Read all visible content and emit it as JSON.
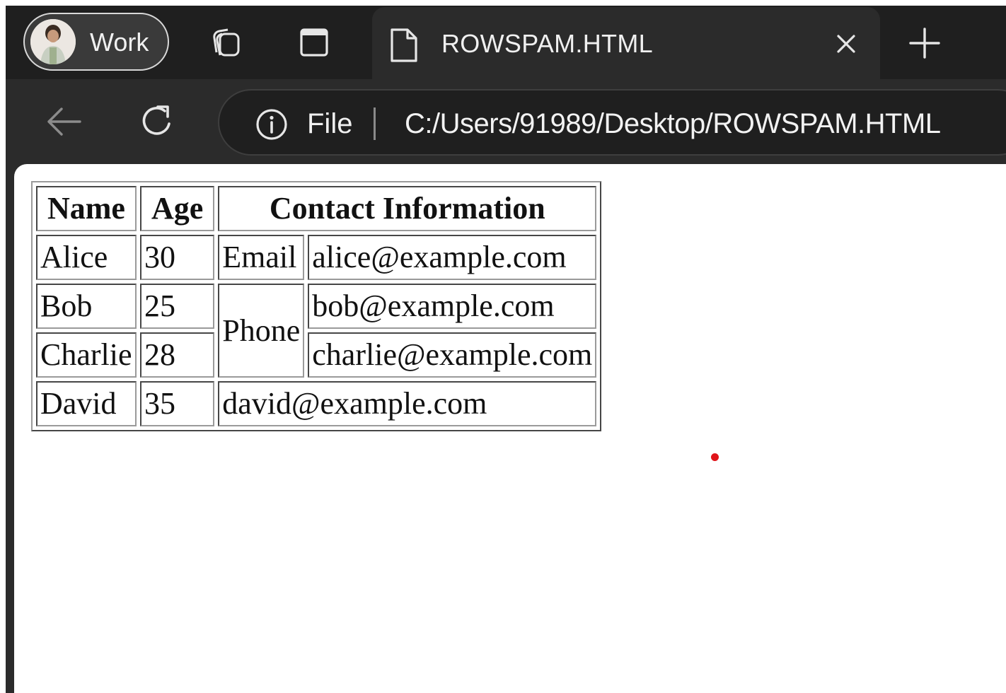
{
  "browser": {
    "profile": {
      "label": "Work"
    },
    "tab": {
      "title": "ROWSPAM.HTML"
    },
    "address": {
      "scheme_label": "File",
      "url": "C:/Users/91989/Desktop/ROWSPAM.HTML"
    },
    "icons": {
      "workspaces": "workspaces-icon",
      "tab_actions": "tab-actions-icon",
      "document": "document-icon",
      "close": "close-icon",
      "new_tab": "plus-icon",
      "back": "back-arrow-icon",
      "reload": "reload-icon",
      "info": "info-icon"
    },
    "colors": {
      "chrome_dark": "#1f1f1f",
      "chrome": "#2b2b2b",
      "text": "#f0f0f0"
    }
  },
  "table": {
    "headers": [
      "Name",
      "Age",
      "Contact Information"
    ],
    "rows": [
      {
        "name": "Alice",
        "age": "30",
        "method": "Email",
        "contact": "alice@example.com"
      },
      {
        "name": "Bob",
        "age": "25",
        "method": "Phone",
        "contact": "bob@example.com"
      },
      {
        "name": "Charlie",
        "age": "28",
        "contact": "charlie@example.com"
      },
      {
        "name": "David",
        "age": "35",
        "contact": "david@example.com"
      }
    ]
  },
  "marker": {
    "color": "#e0141a"
  }
}
